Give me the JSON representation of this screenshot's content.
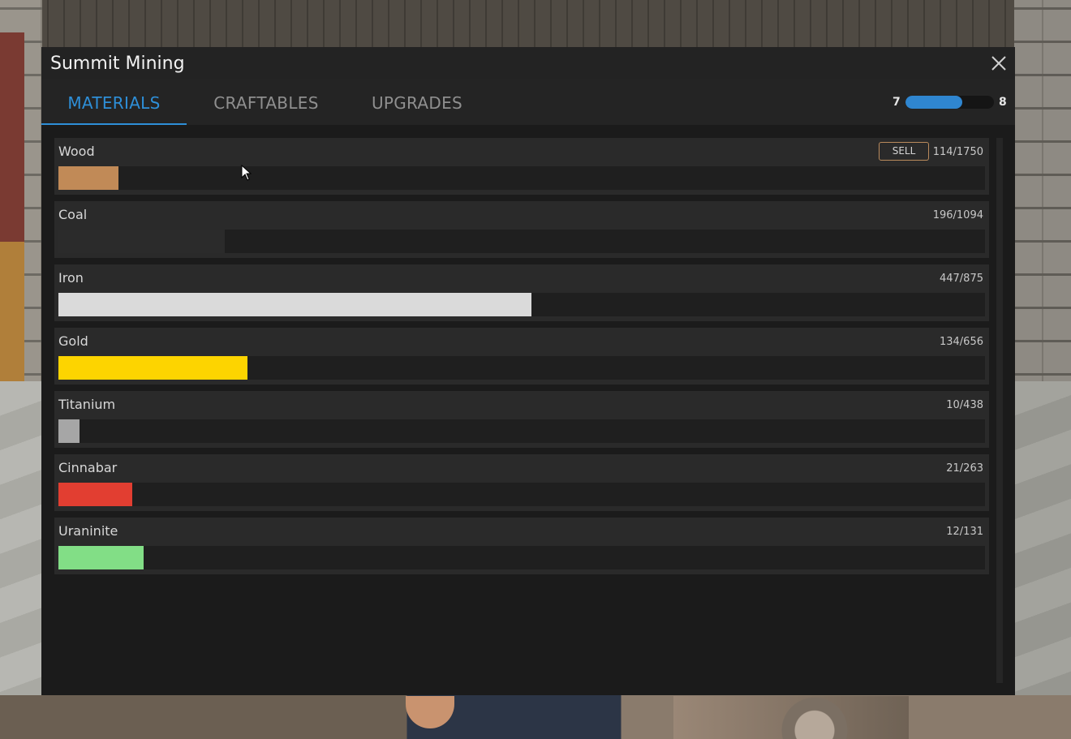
{
  "window": {
    "title": "Summit Mining"
  },
  "tabs": [
    {
      "label": "MATERIALS",
      "active": true
    },
    {
      "label": "CRAFTABLES",
      "active": false
    },
    {
      "label": "UPGRADES",
      "active": false
    }
  ],
  "level": {
    "current": "7",
    "next": "8",
    "progress": 0.64,
    "color": "#2f86d0"
  },
  "sell_label": "SELL",
  "materials": [
    {
      "name": "Wood",
      "count": "114/1750",
      "amount": 114,
      "capacity": 1750,
      "color": "#c18a57",
      "sellable": true
    },
    {
      "name": "Coal",
      "count": "196/1094",
      "amount": 196,
      "capacity": 1094,
      "color": "#2b2b2b",
      "sellable": false
    },
    {
      "name": "Iron",
      "count": "447/875",
      "amount": 447,
      "capacity": 875,
      "color": "#dadada",
      "sellable": false
    },
    {
      "name": "Gold",
      "count": "134/656",
      "amount": 134,
      "capacity": 656,
      "color": "#fdd400",
      "sellable": false
    },
    {
      "name": "Titanium",
      "count": "10/438",
      "amount": 10,
      "capacity": 438,
      "color": "#a6a6a6",
      "sellable": false
    },
    {
      "name": "Cinnabar",
      "count": "21/263",
      "amount": 21,
      "capacity": 263,
      "color": "#e23e31",
      "sellable": false
    },
    {
      "name": "Uraninite",
      "count": "12/131",
      "amount": 12,
      "capacity": 131,
      "color": "#82de86",
      "sellable": false
    }
  ],
  "icons": {
    "close": "close-icon",
    "cursor": "mouse-pointer-icon"
  }
}
